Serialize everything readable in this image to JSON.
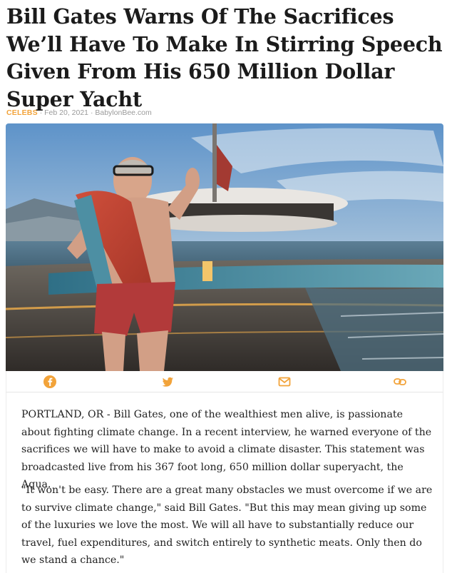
{
  "article": {
    "headline": "Bill Gates Warns Of The Sacrifices We’ll Have To Make In Stirring Speech Given From His 650 Million Dollar Super Yacht",
    "category": "CELEBS",
    "date": "Feb 20, 2021",
    "source": "BabylonBee.com",
    "separator": " · "
  },
  "share": {
    "buttons": [
      {
        "icon": "facebook-icon"
      },
      {
        "icon": "twitter-icon"
      },
      {
        "icon": "email-icon"
      },
      {
        "icon": "link-icon"
      }
    ]
  },
  "body": {
    "paragraphs": [
      "PORTLAND, OR - Bill Gates, one of the wealthiest men alive, is passionate about fighting climate change. In a recent interview, he warned everyone of the sacrifices we will have to make to avoid a climate disaster. This statement was broadcasted live from his 367 foot long, 650 million dollar superyacht, the Aqua.",
      "\"It won't be easy. There are a great many obstacles we must overcome if we are to survive climate change,\" said Bill Gates. \"But this may mean giving up some of the luxuries we love the most. We will all have to substantially reduce our travel, fuel expenditures, and switch entirely to synthetic meats. Only then do we stand a chance.\""
    ]
  },
  "colors": {
    "accent": "#f2a33a",
    "share_icon": "#f2a33a",
    "text": "#222222"
  }
}
